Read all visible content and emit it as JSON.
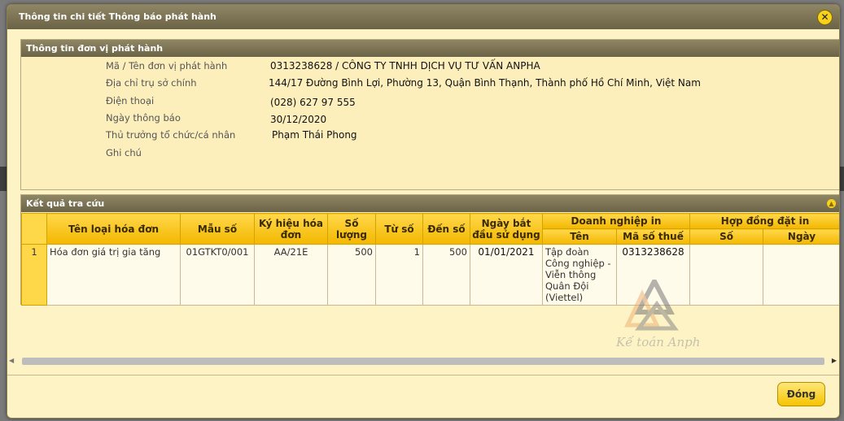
{
  "window": {
    "title": "Thông tin chi tiết Thông báo phát hành",
    "close_icon": "close-icon"
  },
  "issuer_section": {
    "title": "Thông tin đơn vị phát hành",
    "rows": [
      {
        "label": "Mã / Tên đơn vị phát hành",
        "value": "0313238628 / CÔNG TY TNHH DỊCH VỤ TƯ VẤN ANPHA"
      },
      {
        "label": "Địa chỉ trụ sở chính",
        "value": "144/17 Đường Bình Lợi, Phường 13, Quận Bình Thạnh, Thành phố Hồ Chí Minh, Việt Nam"
      },
      {
        "label": "Điện thoại",
        "value": "(028) 627 97 555"
      },
      {
        "label": "Ngày thông báo",
        "value": "30/12/2020"
      },
      {
        "label": "Thủ trưởng tổ chức/cá nhân",
        "value": "Phạm Thái Phong"
      },
      {
        "label": "Ghi chú",
        "value": ""
      }
    ]
  },
  "results_section": {
    "title": "Kết quả tra cứu",
    "headers": {
      "name": "Tên loại hóa đơn",
      "template": "Mẫu số",
      "symbol": "Ký hiệu hóa đơn",
      "quantity": "Số lượng",
      "from": "Từ số",
      "to": "Đến số",
      "start_date": "Ngày bắt đầu sử dụng",
      "enterprise": "Doanh nghiệp in",
      "enterprise_name": "Tên",
      "enterprise_tax": "Mã số thuế",
      "contract": "Hợp đồng đặt in",
      "contract_no": "Số",
      "contract_date": "Ngày"
    },
    "rows": [
      {
        "index": "1",
        "name": "Hóa đơn giá trị gia tăng",
        "template": "01GTKT0/001",
        "symbol": "AA/21E",
        "quantity": "500",
        "from": "1",
        "to": "500",
        "start_date": "01/01/2021",
        "enterprise_name": "Tập đoàn Công nghiệp - Viễn thông Quân Đội (Viettel)",
        "enterprise_tax": "0313238628",
        "contract_no": "",
        "contract_date": ""
      }
    ]
  },
  "watermark": {
    "text": "Kế toán Anpha"
  },
  "footer": {
    "close_label": "Đóng"
  }
}
